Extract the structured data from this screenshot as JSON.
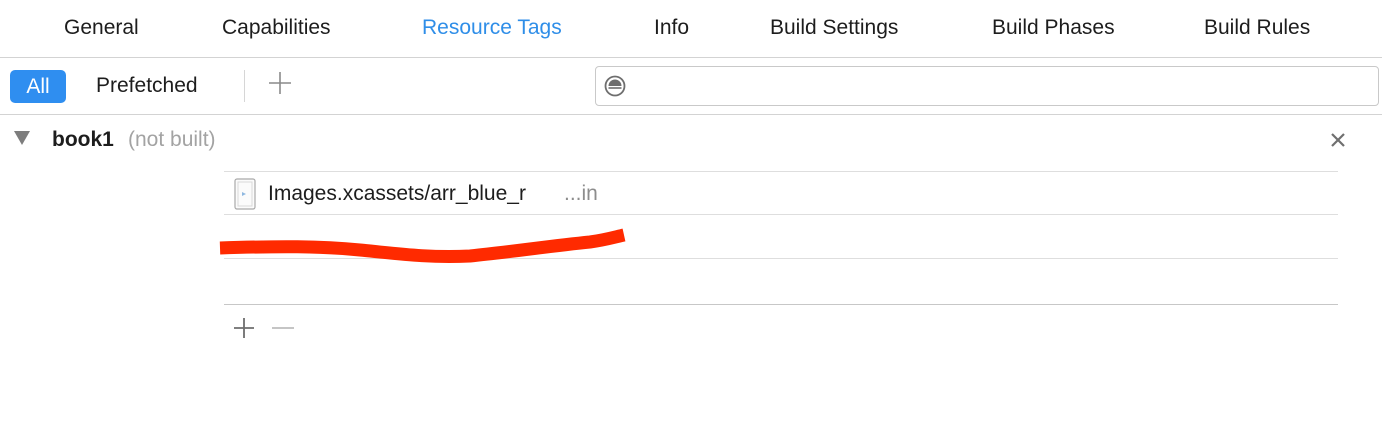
{
  "tabs": [
    {
      "label": "General",
      "active": false
    },
    {
      "label": "Capabilities",
      "active": false
    },
    {
      "label": "Resource Tags",
      "active": true
    },
    {
      "label": "Info",
      "active": false
    },
    {
      "label": "Build Settings",
      "active": false
    },
    {
      "label": "Build Phases",
      "active": false
    },
    {
      "label": "Build Rules",
      "active": false
    }
  ],
  "filter": {
    "all_label": "All",
    "prefetched_label": "Prefetched",
    "add_icon": "plus-icon",
    "search_value": "",
    "search_icon": "filter-icon"
  },
  "target": {
    "name": "book1",
    "status": "(not built)",
    "disclosure_icon": "disclosure-triangle-icon",
    "close_icon": "close-icon"
  },
  "resources": [
    {
      "name": "Images.xcassets/arr_blue_r",
      "suffix": "...in",
      "icon": "asset-file-icon"
    }
  ],
  "footer": {
    "add_icon": "plus-icon",
    "remove_icon": "minus-icon"
  },
  "colors": {
    "accent": "#2f8ee8",
    "redaction": "#ff2a00"
  }
}
